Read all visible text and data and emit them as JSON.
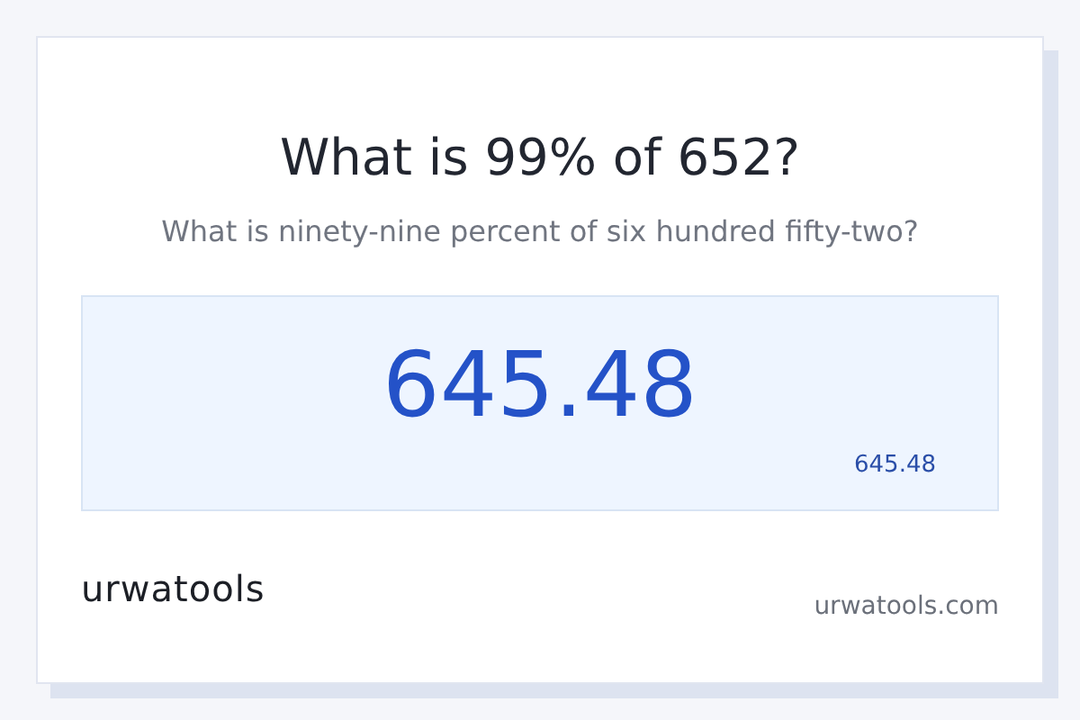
{
  "title": "What is 99% of 652?",
  "subtitle": "What is ninety-nine percent of six hundred fifty-two?",
  "result": {
    "value": "645.48",
    "caption": "645.48"
  },
  "footer": {
    "logo": "urwatools",
    "domain": "urwatools.com"
  }
}
